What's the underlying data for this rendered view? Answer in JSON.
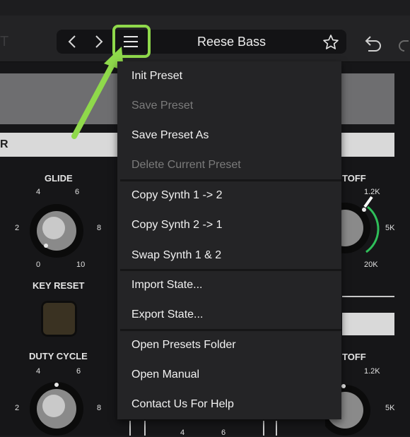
{
  "header": {
    "left_text": "T",
    "preset_name": "Reese Bass",
    "icons": {
      "prev": "chevron-left-icon",
      "next": "chevron-right-icon",
      "menu": "hamburger-menu-icon",
      "favorite": "star-icon",
      "undo": "undo-icon",
      "redo": "redo-icon"
    },
    "highlight_color": "#8fd94b"
  },
  "menu": {
    "items": [
      {
        "label": "Init Preset",
        "enabled": true
      },
      {
        "label": "Save Preset",
        "enabled": false
      },
      {
        "label": "Save Preset As",
        "enabled": true
      },
      {
        "label": "Delete Current Preset",
        "enabled": false
      },
      {
        "label": "Copy Synth 1 -> 2",
        "enabled": true
      },
      {
        "label": "Copy Synth 2 -> 1",
        "enabled": true
      },
      {
        "label": "Swap Synth 1 & 2",
        "enabled": true
      },
      {
        "label": "Import State...",
        "enabled": true
      },
      {
        "label": "Export State...",
        "enabled": true
      },
      {
        "label": "Open Presets Folder",
        "enabled": true
      },
      {
        "label": "Open Manual",
        "enabled": true
      },
      {
        "label": "Contact Us For Help",
        "enabled": true
      }
    ]
  },
  "synth": {
    "section_label_fragment": "R",
    "glide": {
      "label": "GLIDE",
      "ticks": [
        "4",
        "6",
        "2",
        "8",
        "0",
        "10"
      ]
    },
    "key_reset": {
      "label": "KEY RESET"
    },
    "duty_cycle": {
      "label": "DUTY CYCLE",
      "ticks": [
        "4",
        "6",
        "2",
        "8"
      ]
    },
    "cutoff_top": {
      "label": "TOFF",
      "ticks": [
        "1.2K",
        "5K",
        "20K"
      ],
      "accent": "#2fbf5a"
    },
    "cutoff_bottom": {
      "label": "TOFF",
      "ticks": [
        "1.2K",
        "5K"
      ]
    },
    "bottom_ticks": [
      "4",
      "6"
    ]
  }
}
